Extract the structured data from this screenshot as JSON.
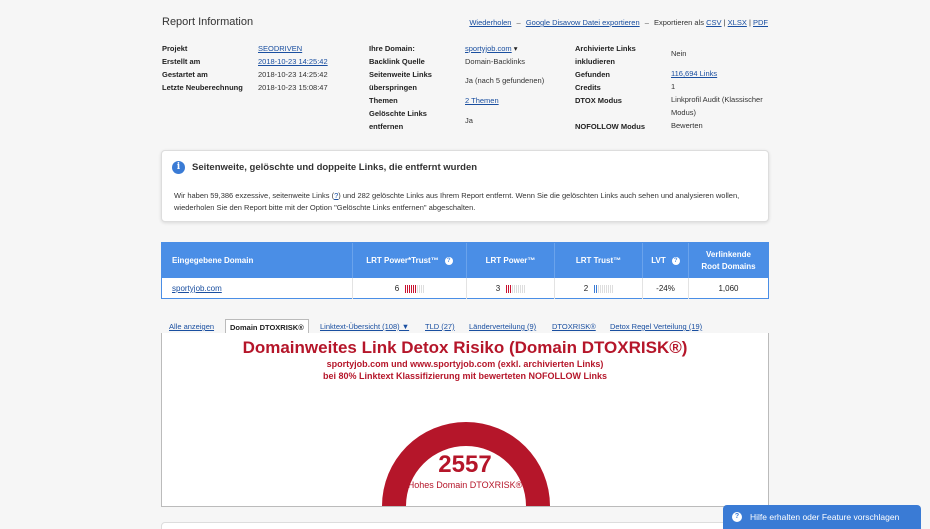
{
  "report": {
    "title": "Report Information",
    "actions": {
      "reload": "Wiederholen",
      "disavow": "Google Disavow Datei exportieren",
      "export_prefix": "Exportieren als",
      "csv": "CSV",
      "xlsx": "XLSX",
      "pdf": "PDF",
      "dash": "–",
      "sep": "|"
    },
    "col1": [
      {
        "k": "Projekt",
        "v": "SEODRIVEN",
        "link": true
      },
      {
        "k": "Erstellt am",
        "v": "2018-10-23 14:25:42",
        "link": true
      },
      {
        "k": "Gestartet am",
        "v": "2018-10-23 14:25:42",
        "link": false
      },
      {
        "k": "Letzte Neuberechnung",
        "v": "2018-10-23 15:08:47",
        "link": false
      }
    ],
    "col2_labels": {
      "domain": "Ihre Domain:",
      "source": "Backlink Quelle",
      "sitewide_1": "Seitenweite Links",
      "sitewide_2": "überspringen",
      "themes": "Themen",
      "deleted_1": "Gelöschte Links",
      "deleted_2": "entfernen"
    },
    "col2_values": {
      "domain": "sportyjob.com",
      "domain_caret": "▾",
      "source": "Domain-Backlinks",
      "sitewide": "Ja (nach 5 gefundenen)",
      "themes": "2 Themen",
      "deleted": "Ja"
    },
    "col3_labels": {
      "archived_1": "Archivierte Links",
      "archived_2": "inkludieren",
      "found": "Gefunden",
      "credits": "Credits",
      "dtox": "DTOX Modus",
      "nofollow": "NOFOLLOW Modus"
    },
    "col3_values": {
      "archived": "Nein",
      "found": "116,694 Links",
      "credits": "1",
      "dtox_1": "Linkprofil Audit (Klassischer",
      "dtox_2": "Modus)",
      "nofollow": "Bewerten"
    }
  },
  "notice": {
    "icon": "info-icon",
    "icon_glyph": "i",
    "title": "Seitenweite, gelöschte und doppeite Links, die entfernt wurden",
    "text_1a": "Wir haben 59,386 exzessive, seitenweite Links (",
    "text_1q": "?",
    "text_1b": ") und 282 gelöschte Links aus Ihrem Report entfernt. Wenn Sie die gelöschten Links auch sehen und analysieren wollen,",
    "text_2": "wiederholen Sie den Report bitte mit der Option \"Gelöschte Links entfernen\" abgeschalten."
  },
  "table": {
    "headers": {
      "domain": "Eingegebene Domain",
      "power_trust": "LRT Power*Trust™",
      "power": "LRT Power™",
      "trust": "LRT Trust™",
      "lvt": "LVT",
      "root_1": "Verlinkende",
      "root_2": "Root Domains"
    },
    "help_glyph": "?",
    "row": {
      "domain": "sportyjob.com",
      "power_trust": "6",
      "power": "3",
      "trust": "2",
      "lvt": "-24%",
      "root": "1,060"
    },
    "bar_levels": {
      "power_trust": 0.6,
      "power": 0.3,
      "trust": 0.2
    },
    "colors": {
      "header": "#4a8ee6",
      "power_trust": "#c8102e",
      "power": "#c8102e",
      "trust": "#3a7bd5"
    }
  },
  "tabs": [
    {
      "label": "Alle anzeigen",
      "active": false
    },
    {
      "label": "Domain DTOXRISK®",
      "active": true
    },
    {
      "label": "Linktext-Übersicht (108) ▼",
      "active": false
    },
    {
      "label": "TLD (27)",
      "active": false
    },
    {
      "label": "Länderverteilung (9)",
      "active": false
    },
    {
      "label": "DTOXRISK®",
      "active": false
    },
    {
      "label": "Detox Regel Verteilung (19)",
      "active": false
    }
  ],
  "risk": {
    "title": "Domainweites Link Detox Risiko (Domain DTOXRISK®)",
    "sub1": "sportyjob.com und www.sportyjob.com (exkl. archivierten Links)",
    "sub2": "bei 80% Linktext Klassifizierung mit bewerteten NOFOLLOW Links",
    "value": "2557",
    "label": "Hohes Domain DTOXRISK®",
    "color": "#b5162a"
  },
  "help": {
    "icon": "help-icon",
    "glyph": "?",
    "label": "Hilfe erhalten oder Feature vorschlagen"
  }
}
